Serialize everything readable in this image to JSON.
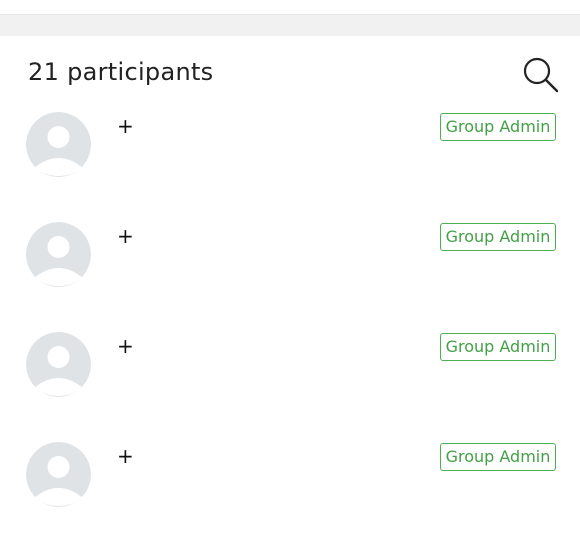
{
  "header": {
    "participants_count": "21 participants",
    "search_icon": "search-icon"
  },
  "participants": [
    {
      "name": "+",
      "role": "Group Admin",
      "avatar_icon": "default-avatar-icon"
    },
    {
      "name": "+",
      "role": "Group Admin",
      "avatar_icon": "default-avatar-icon"
    },
    {
      "name": "+",
      "role": "Group Admin",
      "avatar_icon": "default-avatar-icon"
    },
    {
      "name": "+",
      "role": "Group Admin",
      "avatar_icon": "default-avatar-icon"
    }
  ],
  "colors": {
    "badge_green": "#43a047",
    "avatar_bg": "#dfe3e6",
    "divider_band": "#f1f1f1"
  }
}
